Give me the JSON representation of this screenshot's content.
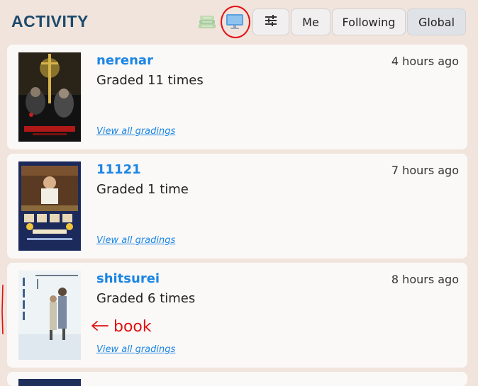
{
  "header": {
    "title": "ACTIVITY",
    "view_icons": [
      "books-icon",
      "monitor-icon"
    ],
    "filter_icon": "sliders-icon",
    "buttons": {
      "me": "Me",
      "following": "Following",
      "global": "Global"
    },
    "selected": "Global"
  },
  "feed": [
    {
      "user": "nerenar",
      "time": "4 hours ago",
      "graded": "Graded 11 times",
      "link": "View all gradings",
      "cover": "death-note-poster"
    },
    {
      "user": "11121",
      "time": "7 hours ago",
      "graded": "Graded 1 time",
      "link": "View all gradings",
      "cover": "drama-poster"
    },
    {
      "user": "shitsurei",
      "time": "8 hours ago",
      "graded": "Graded 6 times",
      "link": "View all gradings",
      "cover": "book-cover"
    }
  ],
  "annotations": {
    "arrow_text": "book",
    "color": "#e01010"
  },
  "colors": {
    "background": "#f1e4dd",
    "card": "#faf9f8",
    "accent": "#1c85e4",
    "title": "#1d4a6b",
    "selected_tab": "#dfe2e7"
  }
}
